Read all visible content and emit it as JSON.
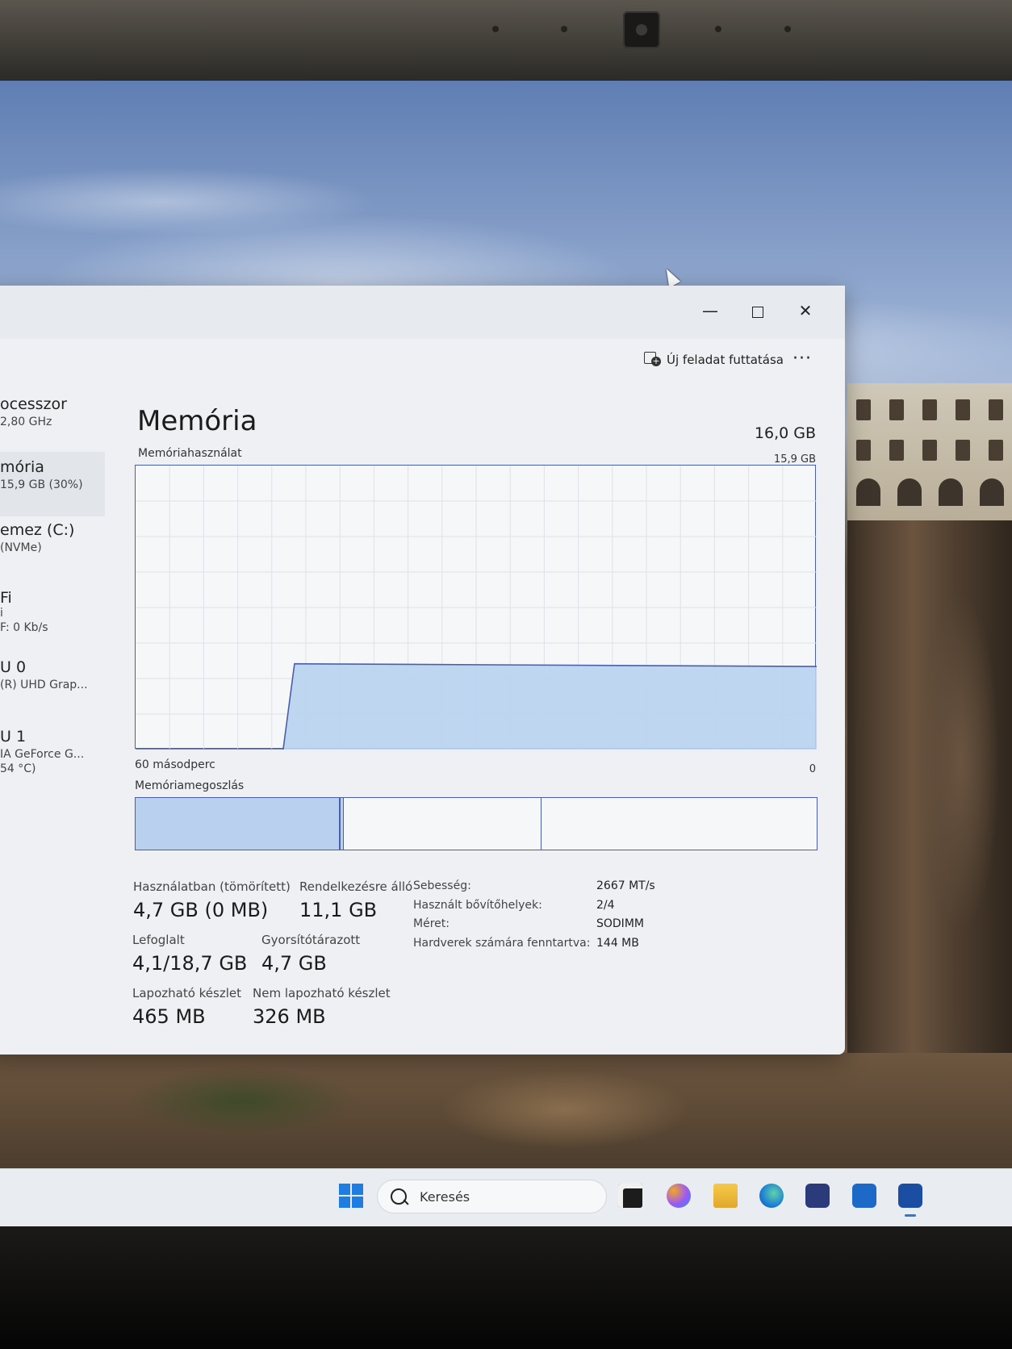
{
  "window": {
    "controls": {
      "minimize": "—",
      "close": "✕"
    },
    "toolbar": {
      "new_task_label": "Új feladat futtatása",
      "more_label": "···"
    }
  },
  "sidebar": {
    "items": [
      {
        "title": "ocesszor",
        "subtitle": "2,80 GHz"
      },
      {
        "title": "mória",
        "subtitle": "15,9 GB (30%)",
        "selected": true
      },
      {
        "title": "emez (C:)",
        "subtitle": "(NVMe)"
      },
      {
        "title": "Fi",
        "subtitle": "i",
        "subtitle2": "F: 0 Kb/s"
      },
      {
        "title": "U 0",
        "subtitle": "(R) UHD Grap..."
      },
      {
        "title": "U 1",
        "subtitle": "IA GeForce G...",
        "subtitle2": "54 °C)"
      }
    ]
  },
  "memory": {
    "title": "Memória",
    "total": "16,0 GB",
    "usage_label": "Memóriahasználat",
    "max_label": "15,9 GB",
    "axis_left": "60 másodperc",
    "axis_right": "0",
    "composition_label": "Memóriamegoszlás",
    "composition": {
      "in_use_fraction": 0.3,
      "modified_fraction": 0.005,
      "standby_fraction": 0.29
    },
    "stats": {
      "in_use": {
        "label": "Használatban (tömörített)",
        "value": "4,7 GB (0 MB)"
      },
      "available": {
        "label": "Rendelkezésre álló",
        "value": "11,1 GB"
      },
      "committed": {
        "label": "Lefoglalt",
        "value": "4,1/18,7 GB"
      },
      "cached": {
        "label": "Gyorsítótárazott",
        "value": "4,7 GB"
      },
      "paged_pool": {
        "label": "Lapozható készlet",
        "value": "465 MB"
      },
      "non_paged_pool": {
        "label": "Nem lapozható készlet",
        "value": "326 MB"
      }
    },
    "info": [
      {
        "key": "Sebesség:",
        "value": "2667 MT/s"
      },
      {
        "key": "Használt bővítőhelyek:",
        "value": "2/4"
      },
      {
        "key": "Méret:",
        "value": "SODIMM"
      },
      {
        "key": "Hardverek számára fenntartva:",
        "value": "144 MB"
      }
    ]
  },
  "chart_data": {
    "type": "area",
    "xlabel": "",
    "ylabel": "",
    "x_range_label": [
      "60 másodperc",
      "0"
    ],
    "ylim": [
      0,
      15.9
    ],
    "x": [
      60,
      50,
      47,
      46,
      0
    ],
    "values": [
      0,
      0,
      0,
      4.8,
      4.65
    ],
    "series": [
      {
        "name": "Memóriahasználat",
        "color": "#b9d1ef"
      }
    ]
  },
  "taskbar": {
    "search_placeholder": "Keresés",
    "icons": [
      "start-icon",
      "search-icon",
      "task-view-icon",
      "copilot-icon",
      "file-explorer-icon",
      "edge-icon",
      "store-icon",
      "outlook-icon",
      "task-manager-icon"
    ]
  }
}
